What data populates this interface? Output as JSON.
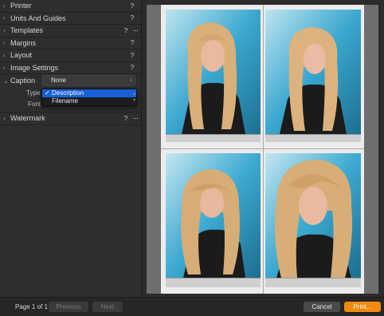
{
  "sidebar": {
    "sections": [
      {
        "label": "Printer",
        "help": "?"
      },
      {
        "label": "Units And Guides",
        "help": "?"
      },
      {
        "label": "Templates",
        "help": "?",
        "menu": "···"
      },
      {
        "label": "Margins",
        "help": "?"
      },
      {
        "label": "Layout",
        "help": "?"
      },
      {
        "label": "Image Settings",
        "help": "?"
      }
    ],
    "caption": {
      "label": "Caption",
      "selected": "None",
      "type_label": "Type",
      "font_label": "Font",
      "options": [
        "Description",
        "Filename"
      ],
      "checked": "✓"
    },
    "watermark": {
      "label": "Watermark",
      "help": "?",
      "menu": "···"
    }
  },
  "icons": {
    "chevron": "chevron-right-icon",
    "check": "checkmark-icon"
  },
  "footer": {
    "page": "Page 1 of 1",
    "previous": "Previous",
    "next": "Next",
    "cancel": "Cancel",
    "print": "Print..."
  },
  "colors": {
    "accent": "#1a5fd6",
    "print": "#f28a10"
  }
}
